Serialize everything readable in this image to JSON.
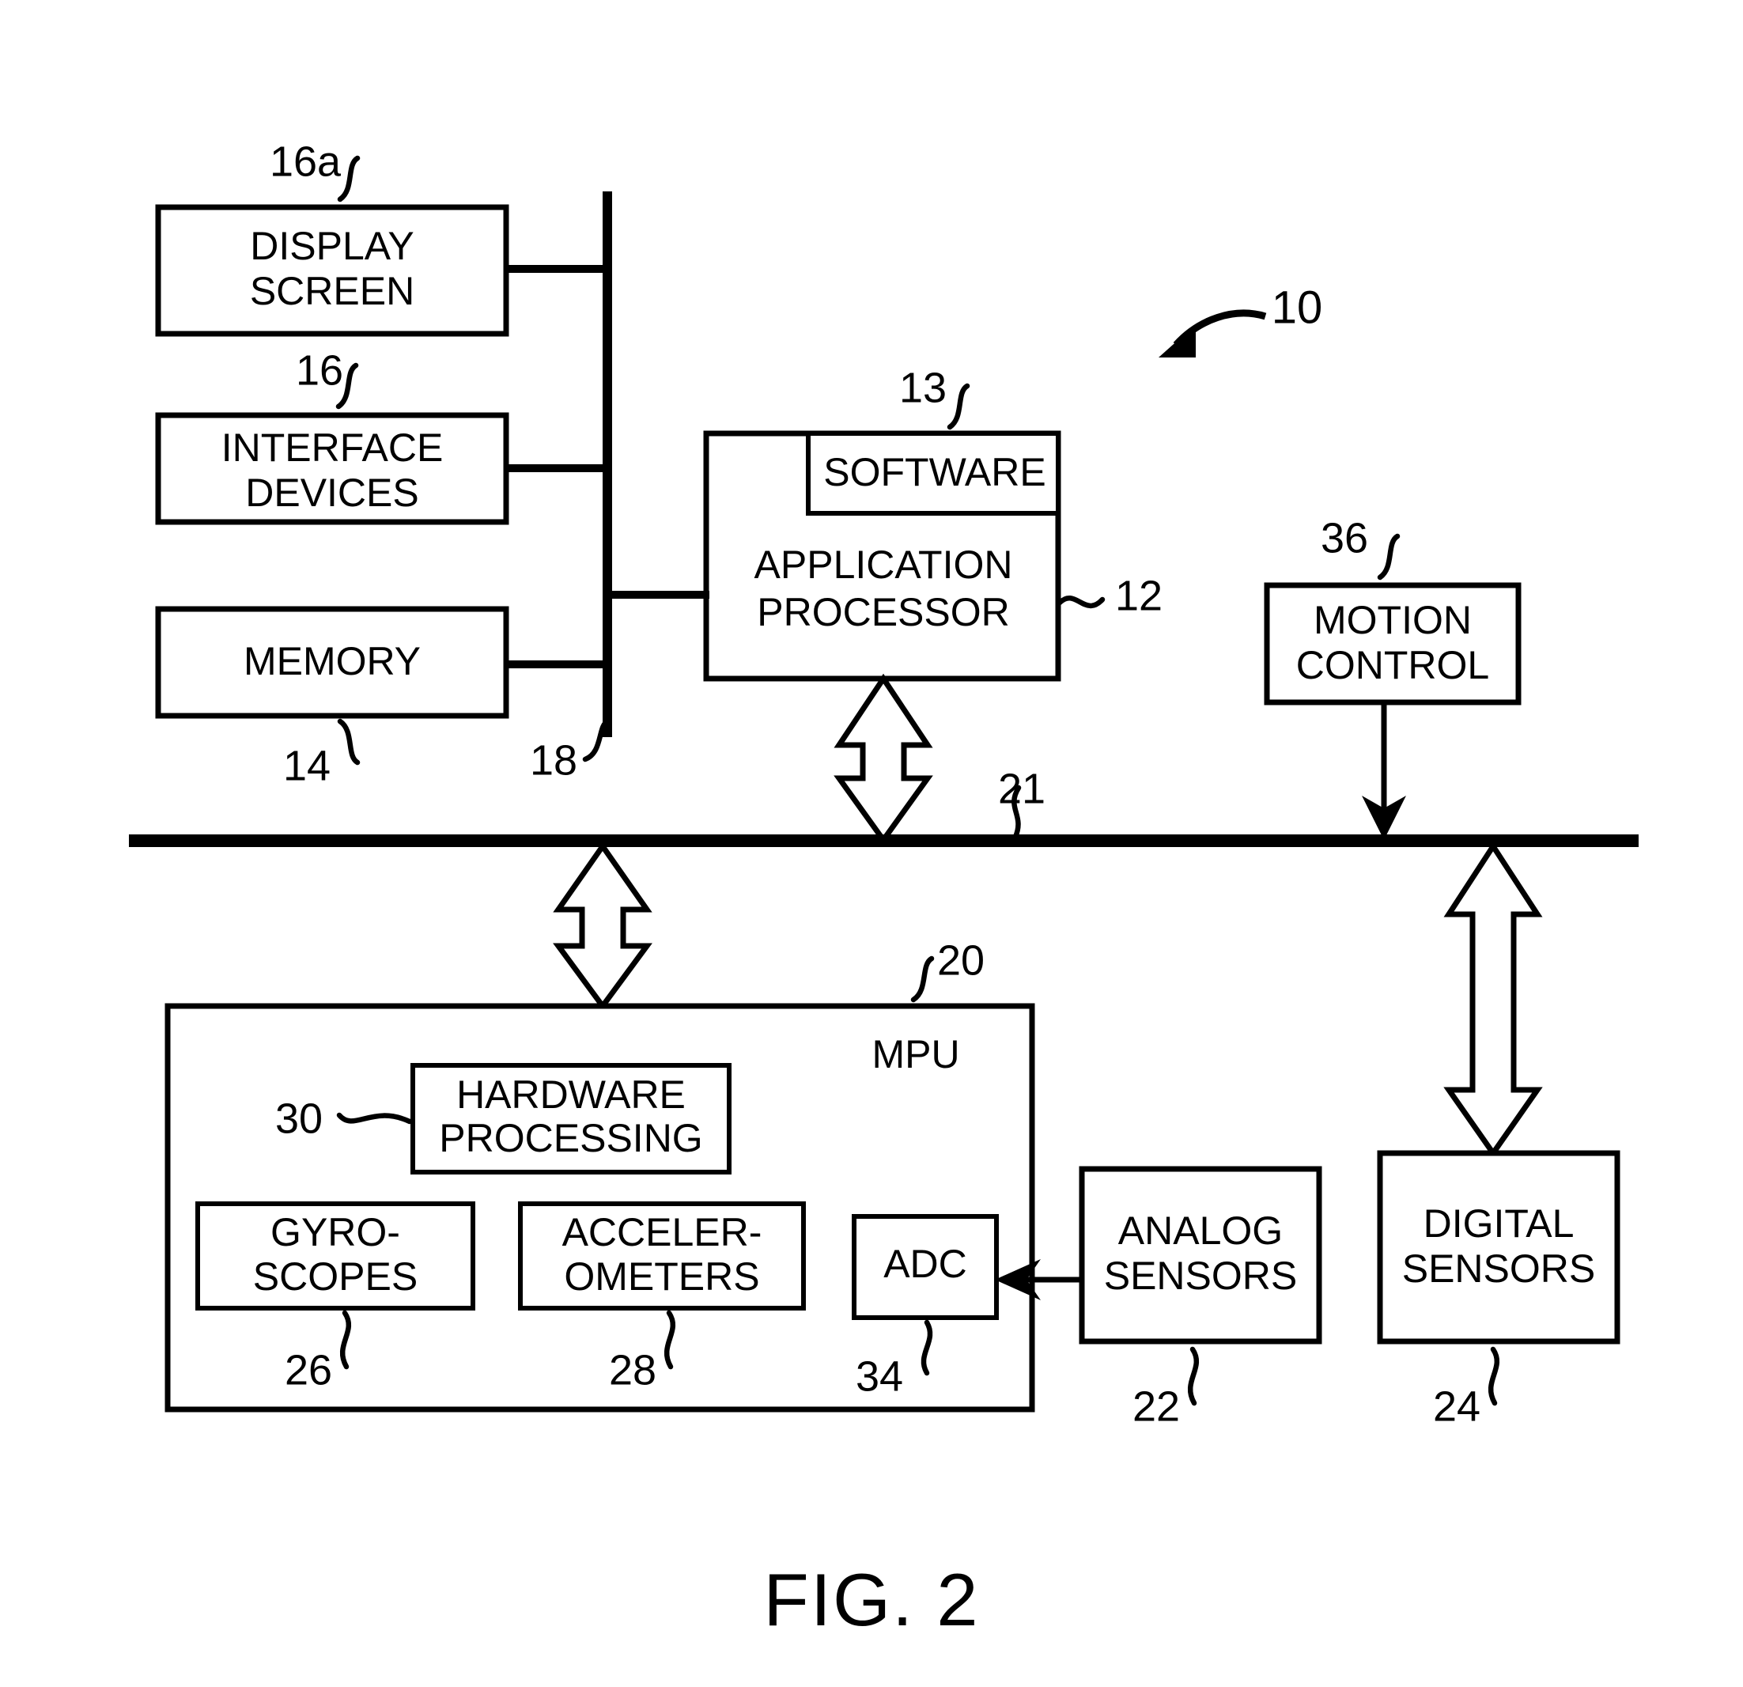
{
  "figure": {
    "caption": "FIG. 2",
    "system_ref": "10"
  },
  "blocks": {
    "display_screen": {
      "label_line1": "DISPLAY",
      "label_line2": "SCREEN",
      "ref": "16a"
    },
    "interface_devices": {
      "label_line1": "INTERFACE",
      "label_line2": "DEVICES",
      "ref": "16"
    },
    "memory": {
      "label_line1": "MEMORY",
      "label_line2": "",
      "ref": "14"
    },
    "internal_bus": {
      "ref": "18"
    },
    "application_processor": {
      "label_line1": "APPLICATION",
      "label_line2": "PROCESSOR",
      "ref": "12"
    },
    "software": {
      "label_line1": "SOFTWARE",
      "ref": "13"
    },
    "motion_control": {
      "label_line1": "MOTION",
      "label_line2": "CONTROL",
      "ref": "36"
    },
    "system_bus": {
      "ref": "21"
    },
    "mpu": {
      "label": "MPU",
      "ref": "20"
    },
    "hardware_processing": {
      "label_line1": "HARDWARE",
      "label_line2": "PROCESSING",
      "ref": "30"
    },
    "gyroscopes": {
      "label_line1": "GYRO-",
      "label_line2": "SCOPES",
      "ref": "26"
    },
    "accelerometers": {
      "label_line1": "ACCELER-",
      "label_line2": "OMETERS",
      "ref": "28"
    },
    "adc": {
      "label_line1": "ADC",
      "ref": "34"
    },
    "analog_sensors": {
      "label_line1": "ANALOG",
      "label_line2": "SENSORS",
      "ref": "22"
    },
    "digital_sensors": {
      "label_line1": "DIGITAL",
      "label_line2": "SENSORS",
      "ref": "24"
    }
  },
  "colors": {
    "ink": "#000000",
    "paper": "#ffffff"
  }
}
